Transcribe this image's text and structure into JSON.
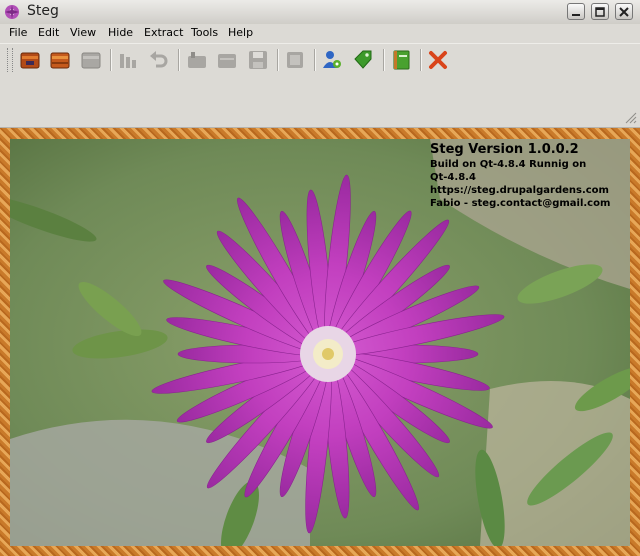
{
  "window": {
    "title": "Steg"
  },
  "menu": [
    {
      "label": "File"
    },
    {
      "label": "Edit"
    },
    {
      "label": "View"
    },
    {
      "label": "Hide"
    },
    {
      "label": "Extract"
    },
    {
      "label": "Tools"
    },
    {
      "label": "Help"
    }
  ],
  "toolbar": {
    "buttons": [
      {
        "icon": "open-chest-icon",
        "enabled": true
      },
      {
        "icon": "chest-icon",
        "enabled": true
      },
      {
        "icon": "chest-disabled-icon",
        "enabled": false
      },
      {
        "icon": "columns-icon",
        "enabled": false
      },
      {
        "icon": "undo-icon",
        "enabled": false
      },
      {
        "icon": "import-icon",
        "enabled": false
      },
      {
        "icon": "export-icon",
        "enabled": false
      },
      {
        "icon": "save-icon",
        "enabled": false
      },
      {
        "icon": "chip-icon",
        "enabled": false
      },
      {
        "icon": "user-settings-icon",
        "enabled": true
      },
      {
        "icon": "green-tag-icon",
        "enabled": true
      },
      {
        "icon": "book-icon",
        "enabled": true
      },
      {
        "icon": "close-x-icon",
        "enabled": true
      }
    ]
  },
  "info": {
    "version": "Steg Version 1.0.0.2",
    "build": "Build on Qt-4.8.4 Runnig on",
    "qt": "Qt-4.8.4",
    "url": "https://steg.drupalgardens.com",
    "contact": "Fabio - steg.contact@gmail.com"
  },
  "colors": {
    "frame": "#d98a3a",
    "petal": "#c23fbf",
    "foliage": "#6f8f4a"
  }
}
